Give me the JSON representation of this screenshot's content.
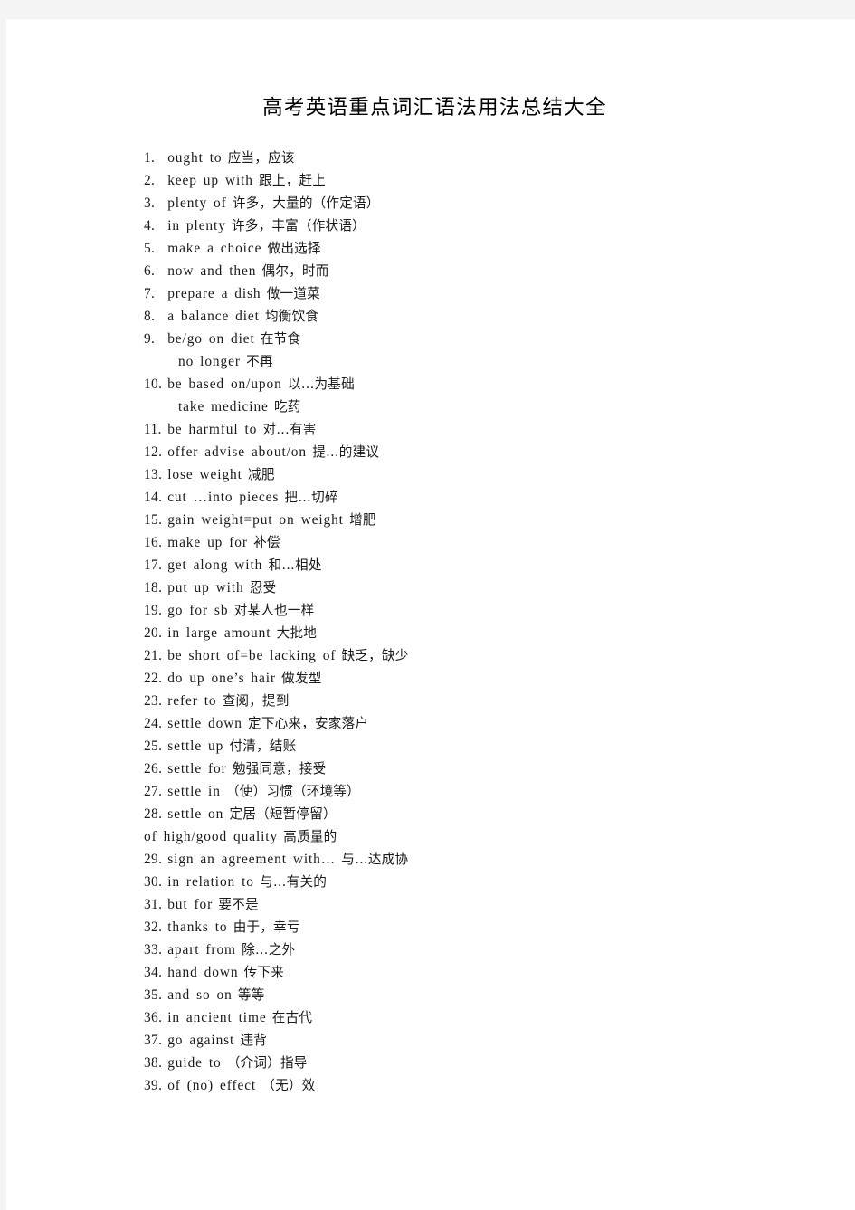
{
  "document": {
    "title": "高考英语重点词汇语法用法总结大全",
    "page_background": "#ffffff",
    "margin_background": "#f4f4f4",
    "text_color": "#1a1a1a"
  },
  "entries": [
    {
      "num": "1.",
      "eng": "ought to",
      "cjk": "应当，应该",
      "sub": false
    },
    {
      "num": "2.",
      "eng": "keep up with",
      "cjk": "跟上，赶上",
      "sub": false
    },
    {
      "num": "3.",
      "eng": "plenty of",
      "cjk": "许多，大量的（作定语）",
      "sub": false
    },
    {
      "num": "4.",
      "eng": "in plenty",
      "cjk": "许多，丰富（作状语）",
      "sub": false
    },
    {
      "num": "5.",
      "eng": "make a choice",
      "cjk": "做出选择",
      "sub": false
    },
    {
      "num": "6.",
      "eng": "now and then",
      "cjk": "偶尔，时而",
      "sub": false
    },
    {
      "num": "7.",
      "eng": "prepare a dish",
      "cjk": "做一道菜",
      "sub": false
    },
    {
      "num": "8.",
      "eng": "a balance diet",
      "cjk": "均衡饮食",
      "sub": false
    },
    {
      "num": "9.",
      "eng": "be/go on diet",
      "cjk": "在节食",
      "sub": false
    },
    {
      "num": "",
      "eng": "no longer",
      "cjk": "不再",
      "sub": true
    },
    {
      "num": "10.",
      "eng": "be based on/upon",
      "cjk": "以…为基础",
      "sub": false
    },
    {
      "num": "",
      "eng": "take medicine",
      "cjk": "吃药",
      "sub": true
    },
    {
      "num": "11.",
      "eng": "be harmful to",
      "cjk": "对…有害",
      "sub": false
    },
    {
      "num": "12.",
      "eng": "offer advise about/on",
      "cjk": "提…的建议",
      "sub": false
    },
    {
      "num": "13.",
      "eng": "lose weight",
      "cjk": "减肥",
      "sub": false
    },
    {
      "num": "14.",
      "eng": "cut …into pieces",
      "cjk": "把…切碎",
      "sub": false
    },
    {
      "num": "15.",
      "eng": "gain weight=put on weight",
      "cjk": "增肥",
      "sub": false
    },
    {
      "num": "16.",
      "eng": "make up for",
      "cjk": "补偿",
      "sub": false
    },
    {
      "num": "17.",
      "eng": "get along with",
      "cjk": "和…相处",
      "sub": false
    },
    {
      "num": "18.",
      "eng": "put up with",
      "cjk": "忍受",
      "sub": false
    },
    {
      "num": "19.",
      "eng": "go for sb",
      "cjk": "对某人也一样",
      "sub": false
    },
    {
      "num": "20.",
      "eng": "in large amount",
      "cjk": "大批地",
      "sub": false
    },
    {
      "num": "21.",
      "eng": "be short of=be lacking of",
      "cjk": " 缺乏，缺少",
      "sub": false
    },
    {
      "num": "22.",
      "eng": "do up one’s hair",
      "cjk": "做发型",
      "sub": false
    },
    {
      "num": "23.",
      "eng": "refer to",
      "cjk": "查阅，提到",
      "sub": false
    },
    {
      "num": "24.",
      "eng": "settle down",
      "cjk": "定下心来，安家落户",
      "sub": false
    },
    {
      "num": "25.",
      "eng": "settle up",
      "cjk": "付清，结账",
      "sub": false
    },
    {
      "num": "26.",
      "eng": "settle for",
      "cjk": "勉强同意，接受",
      "sub": false
    },
    {
      "num": "27.",
      "eng": "settle in",
      "cjk": "（使）习惯（环境等）",
      "sub": false
    },
    {
      "num": "28.",
      "eng": "settle on",
      "cjk": "定居（短暂停留）",
      "sub": false
    },
    {
      "num": "",
      "eng": "of high/good quality",
      "cjk": "高质量的",
      "sub": false
    },
    {
      "num": "29.",
      "eng": "sign an agreement with…",
      "cjk": "与…达成协",
      "sub": false
    },
    {
      "num": "30.",
      "eng": "in relation to",
      "cjk": "与…有关的",
      "sub": false
    },
    {
      "num": "31.",
      "eng": "but for",
      "cjk": "要不是",
      "sub": false
    },
    {
      "num": "32.",
      "eng": "thanks to",
      "cjk": "由于，幸亏",
      "sub": false
    },
    {
      "num": "33.",
      "eng": "apart from",
      "cjk": "除…之外",
      "sub": false
    },
    {
      "num": "34.",
      "eng": "hand down",
      "cjk": "传下来",
      "sub": false
    },
    {
      "num": "35.",
      "eng": "and so on",
      "cjk": "等等",
      "sub": false
    },
    {
      "num": "36.",
      "eng": "in ancient time",
      "cjk": "在古代",
      "sub": false
    },
    {
      "num": "37.",
      "eng": "go against",
      "cjk": "违背",
      "sub": false
    },
    {
      "num": "38.",
      "eng": "guide to",
      "cjk": "（介词）指导",
      "sub": false
    },
    {
      "num": "39.",
      "eng": "of (no) effect",
      "cjk": "（无）效",
      "sub": false
    }
  ]
}
